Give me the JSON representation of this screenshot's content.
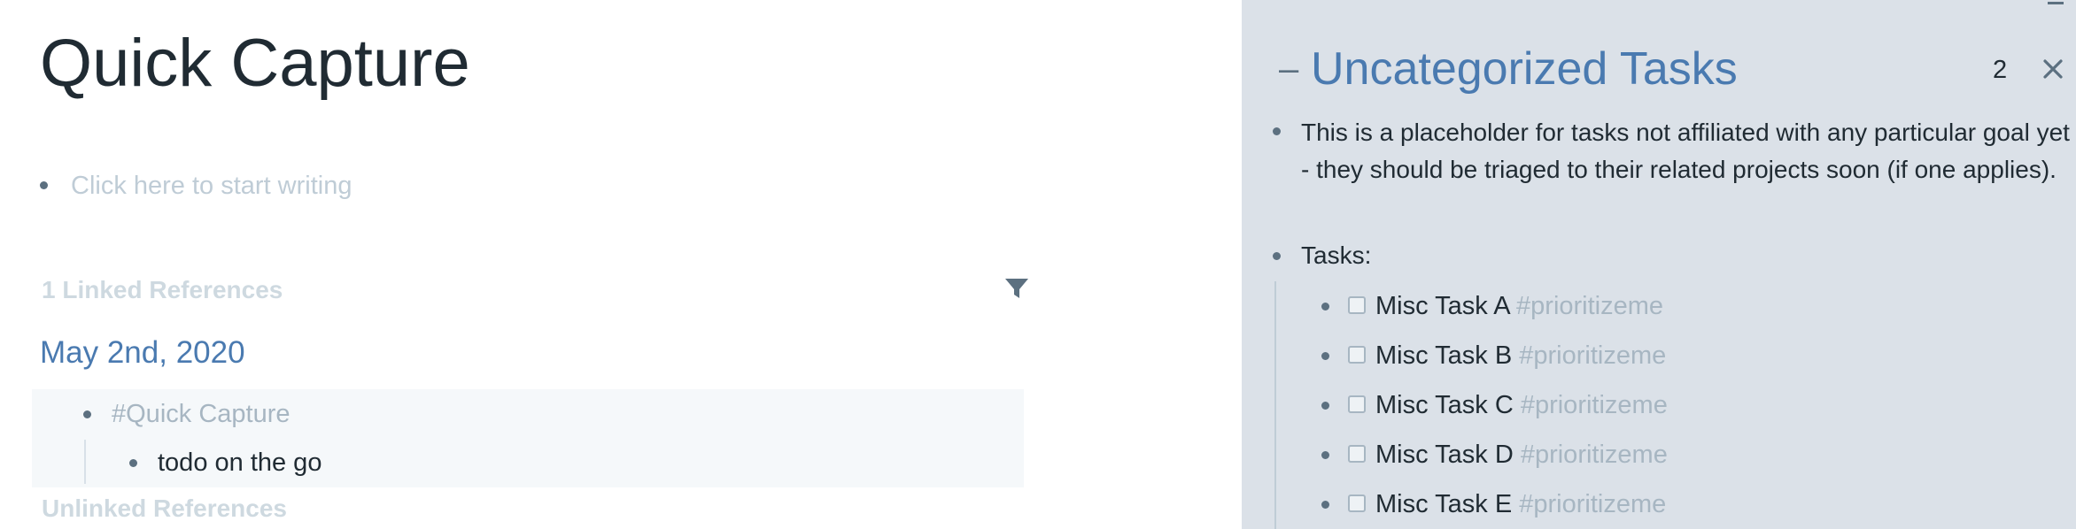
{
  "main": {
    "title": "Quick Capture",
    "placeholder": "Click here to start writing",
    "linked_refs_heading": "1 Linked References",
    "filter_icon": "filter-icon",
    "reference": {
      "date": "May 2nd, 2020",
      "tag": "#Quick Capture",
      "child": "todo on the go"
    },
    "unlinked_refs_heading": "Unlinked References"
  },
  "sidebar": {
    "collapse_symbol": "–",
    "title": "Uncategorized Tasks",
    "count": "2",
    "close_icon": "close-icon",
    "description": "This is a placeholder for tasks not affiliated with any particular goal yet - they should be triaged to their related projects soon (if one applies).",
    "tasks_label": "Tasks:",
    "tasks": [
      {
        "name": "Misc Task A",
        "tag": "#prioritizeme"
      },
      {
        "name": "Misc Task B",
        "tag": "#prioritizeme"
      },
      {
        "name": "Misc Task C",
        "tag": "#prioritizeme"
      },
      {
        "name": "Misc Task D",
        "tag": "#prioritizeme"
      },
      {
        "name": "Misc Task E",
        "tag": "#prioritizeme"
      }
    ]
  },
  "colors": {
    "title_text": "#202b33",
    "link_blue": "#4a7ab0",
    "muted_text": "#a7b6c2",
    "placeholder_text": "#bfccd6",
    "sidebar_bg": "#dbe1e8",
    "ref_block_bg": "#f5f8fa"
  }
}
